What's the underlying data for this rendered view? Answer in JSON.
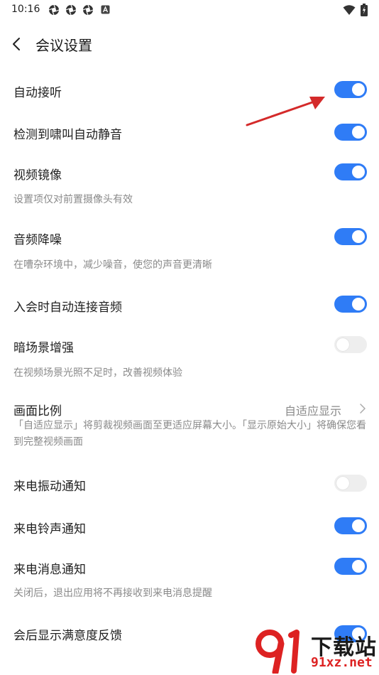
{
  "status_bar": {
    "time": "10:16",
    "icons": [
      "camera-aperture-icon",
      "camera-aperture-icon",
      "camera-aperture-icon",
      "a-square-icon",
      "wifi-icon",
      "battery-charging-icon"
    ]
  },
  "header": {
    "title": "会议设置",
    "back_icon": "chevron-left-icon"
  },
  "settings": [
    {
      "label": "自动接听",
      "toggle": true
    },
    {
      "label": "检测到啸叫自动静音",
      "toggle": true
    },
    {
      "label": "视频镜像",
      "toggle": true,
      "description": "设置项仅对前置摄像头有效"
    },
    {
      "label": "音频降噪",
      "toggle": true,
      "description": "在嘈杂环境中，减少噪音，使您的声音更清晰"
    },
    {
      "label": "入会时自动连接音频",
      "toggle": true
    },
    {
      "label": "暗场景增强",
      "toggle": false,
      "description": "在视频场景光照不足时，改善视频体验"
    },
    {
      "label": "画面比例",
      "value": "自适应显示",
      "description": "「自适应显示」将剪裁视频画面至更适应屏幕大小。「显示原始大小」将确保您看到完整视频画面"
    },
    {
      "label": "来电振动通知",
      "toggle": false
    },
    {
      "label": "来电铃声通知",
      "toggle": true
    },
    {
      "label": "来电消息通知",
      "toggle": true,
      "description": "关闭后，退出应用将不再接收到来电消息提醒"
    },
    {
      "label": "会后显示满意度反馈",
      "toggle": true
    }
  ],
  "watermark": {
    "text": "下载站",
    "url": "91xz.net"
  },
  "colors": {
    "toggle_on": "#2f7cf6",
    "toggle_off": "#eeeeee",
    "annotation_arrow": "#d42a2a"
  }
}
